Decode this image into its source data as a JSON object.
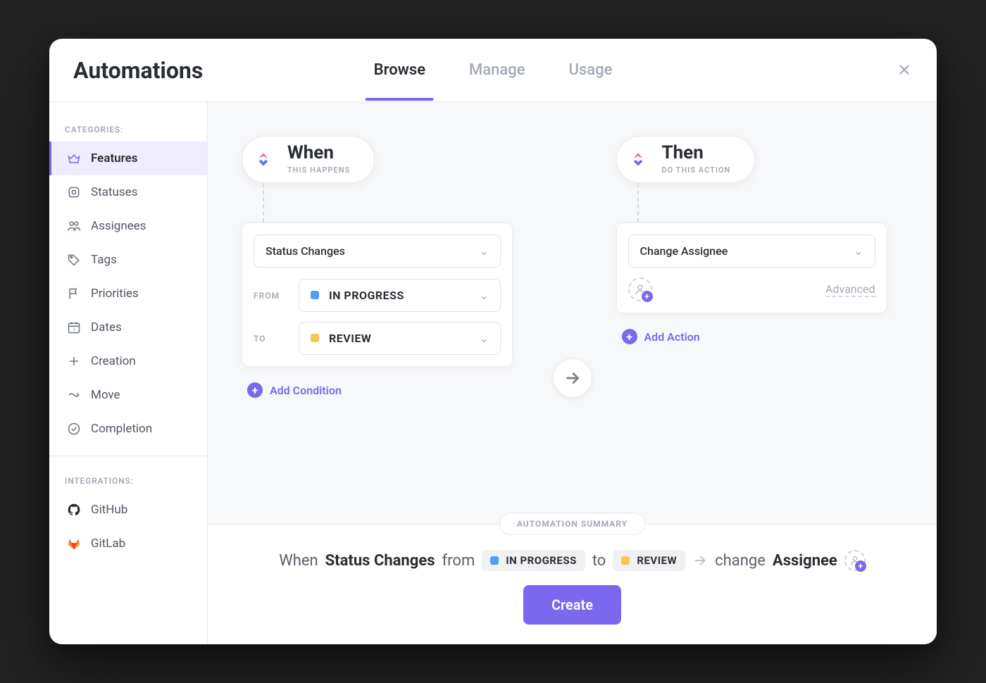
{
  "header": {
    "title": "Automations",
    "tabs": [
      {
        "label": "Browse",
        "active": true
      },
      {
        "label": "Manage",
        "active": false
      },
      {
        "label": "Usage",
        "active": false
      }
    ]
  },
  "sidebar": {
    "categories_label": "CATEGORIES:",
    "integrations_label": "INTEGRATIONS:",
    "items": [
      {
        "icon": "crown",
        "label": "Features",
        "active": true
      },
      {
        "icon": "status",
        "label": "Statuses"
      },
      {
        "icon": "people",
        "label": "Assignees"
      },
      {
        "icon": "tag",
        "label": "Tags"
      },
      {
        "icon": "flag",
        "label": "Priorities"
      },
      {
        "icon": "calendar",
        "label": "Dates"
      },
      {
        "icon": "plus-square",
        "label": "Creation"
      },
      {
        "icon": "move",
        "label": "Move"
      },
      {
        "icon": "check-circle",
        "label": "Completion"
      }
    ],
    "integrations": [
      {
        "icon": "github",
        "label": "GitHub"
      },
      {
        "icon": "gitlab",
        "label": "GitLab"
      }
    ]
  },
  "when": {
    "title": "When",
    "subtitle": "THIS HAPPENS",
    "trigger_label": "Status Changes",
    "from_label": "FROM",
    "to_label": "TO",
    "from_status": {
      "name": "IN PROGRESS",
      "color": "#4f9cf9"
    },
    "to_status": {
      "name": "REVIEW",
      "color": "#f9c74f"
    },
    "add_condition_label": "Add Condition"
  },
  "then": {
    "title": "Then",
    "subtitle": "DO THIS ACTION",
    "action_label": "Change Assignee",
    "advanced_label": "Advanced",
    "add_action_label": "Add Action"
  },
  "summary": {
    "badge": "AUTOMATION SUMMARY",
    "when_word": "When",
    "trigger": "Status Changes",
    "from_word": "from",
    "to_word": "to",
    "change_word": "change",
    "target": "Assignee",
    "create_button": "Create"
  }
}
